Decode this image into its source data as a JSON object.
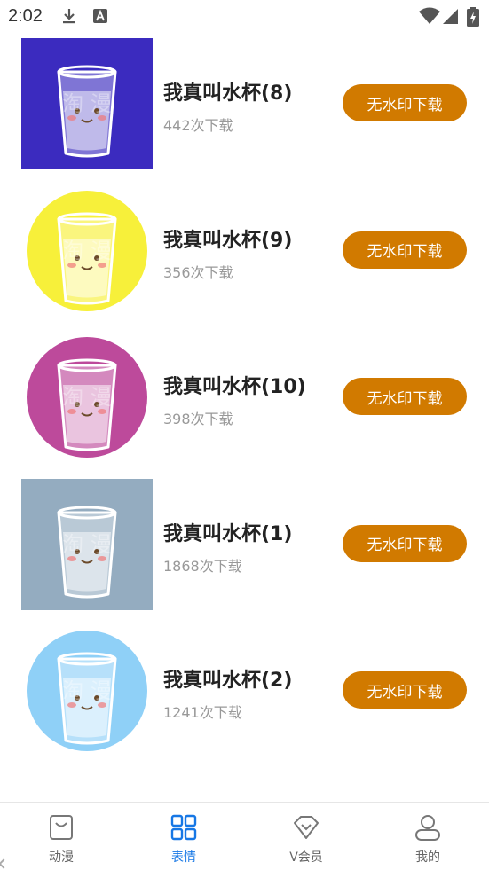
{
  "status_bar": {
    "time": "2:02",
    "left_icons": [
      "download-icon",
      "keyboard-icon"
    ],
    "right_icons": [
      "wifi-icon",
      "signal-icon",
      "battery-charging-icon"
    ]
  },
  "items": [
    {
      "title": "我真叫水杯(8)",
      "count": "442次下载",
      "button": "无水印下载",
      "watermark": "淘   漫",
      "bg": "#3b2bbf",
      "shape": "square"
    },
    {
      "title": "我真叫水杯(9)",
      "count": "356次下载",
      "button": "无水印下载",
      "watermark": "淘   漫",
      "bg": "#f7f03a",
      "shape": "circle"
    },
    {
      "title": "我真叫水杯(10)",
      "count": "398次下载",
      "button": "无水印下载",
      "watermark": "淘   漫",
      "bg": "#bd4a9b",
      "shape": "circle"
    },
    {
      "title": "我真叫水杯(1)",
      "count": "1868次下载",
      "button": "无水印下载",
      "watermark": "淘   漫",
      "bg": "#94acc0",
      "shape": "square"
    },
    {
      "title": "我真叫水杯(2)",
      "count": "1241次下载",
      "button": "无水印下载",
      "watermark": "淘   漫",
      "bg": "#8fd0f7",
      "shape": "circle"
    }
  ],
  "bottom_nav": [
    {
      "label": "动漫",
      "icon": "bag-icon",
      "active": false
    },
    {
      "label": "表情",
      "icon": "grid-icon",
      "active": true
    },
    {
      "label": "V会员",
      "icon": "diamond-icon",
      "active": false
    },
    {
      "label": "我的",
      "icon": "person-icon",
      "active": false
    }
  ],
  "colors": {
    "button_bg": "#d17a00",
    "active_nav": "#1677e5",
    "inactive_nav": "#666666"
  }
}
